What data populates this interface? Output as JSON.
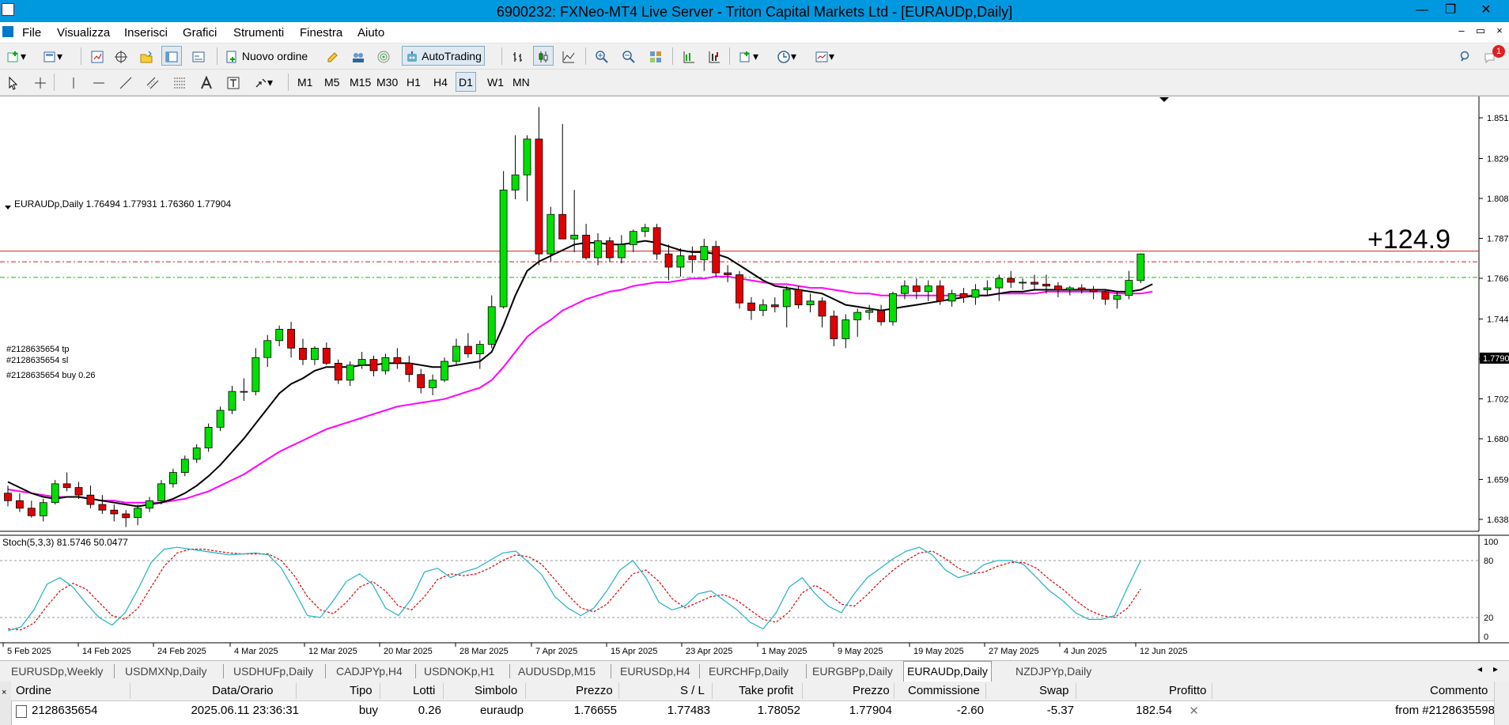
{
  "window": {
    "title": "6900232: FXNeo-MT4 Live Server - Triton Capital Markets Ltd - [EURAUDp,Daily]",
    "min_glyph": "—",
    "max_glyph": "❐",
    "close_glyph": "✕"
  },
  "menu": {
    "items": [
      "File",
      "Visualizza",
      "Inserisci",
      "Grafici",
      "Strumenti",
      "Finestra",
      "Aiuto"
    ],
    "mdi_min": "–",
    "mdi_restore": "▭",
    "mdi_close": "×"
  },
  "toolbar": {
    "new_order_label": "Nuovo ordine",
    "autotrading_label": "AutoTrading",
    "notification_count": "1"
  },
  "timeframes": [
    "M1",
    "M5",
    "M15",
    "M30",
    "H1",
    "H4",
    "D1",
    "W1",
    "MN"
  ],
  "active_timeframe": "D1",
  "chart": {
    "header": "EURAUDp,Daily  1.76494 1.77931 1.76360 1.77904",
    "profit_overlay": "+124.9",
    "current_price": "1.77904",
    "order_labels": {
      "tp": "#2128635654 tp",
      "sl": "#2128635654 sl",
      "buy": "#2128635654 buy 0.26"
    },
    "price_axis": [
      "1.85130",
      "1.82970",
      "1.80850",
      "1.78730",
      "1.76610",
      "1.74450",
      "1.72330",
      "1.70210",
      "1.68090",
      "1.65930",
      "1.63810"
    ],
    "date_axis": [
      "5 Feb 2025",
      "14 Feb 2025",
      "24 Feb 2025",
      "4 Mar 2025",
      "12 Mar 2025",
      "20 Mar 2025",
      "28 Mar 2025",
      "7 Apr 2025",
      "15 Apr 2025",
      "23 Apr 2025",
      "1 May 2025",
      "9 May 2025",
      "19 May 2025",
      "27 May 2025",
      "4 Jun 2025",
      "12 Jun 2025"
    ],
    "stoch_header": "Stoch(5,3,3) 81.5746 50.0477",
    "stoch_axis": [
      "100",
      "80",
      "20",
      "0"
    ],
    "colors": {
      "bull": "#00e000",
      "bear": "#e00000",
      "ma_fast": "#000000",
      "ma_slow": "#ff00ff",
      "stoch_main": "#20b2c0",
      "stoch_signal": "#e00000",
      "profit": "#c8b070"
    }
  },
  "chart_data": {
    "type": "candlestick",
    "symbol": "EURAUDp",
    "timeframe": "Daily",
    "candles": [
      {
        "o": 1.652,
        "h": 1.656,
        "l": 1.645,
        "c": 1.648
      },
      {
        "o": 1.648,
        "h": 1.652,
        "l": 1.642,
        "c": 1.644
      },
      {
        "o": 1.644,
        "h": 1.648,
        "l": 1.639,
        "c": 1.64
      },
      {
        "o": 1.64,
        "h": 1.649,
        "l": 1.637,
        "c": 1.647
      },
      {
        "o": 1.647,
        "h": 1.659,
        "l": 1.646,
        "c": 1.657
      },
      {
        "o": 1.657,
        "h": 1.663,
        "l": 1.653,
        "c": 1.655
      },
      {
        "o": 1.655,
        "h": 1.658,
        "l": 1.649,
        "c": 1.651
      },
      {
        "o": 1.651,
        "h": 1.656,
        "l": 1.644,
        "c": 1.646
      },
      {
        "o": 1.646,
        "h": 1.651,
        "l": 1.641,
        "c": 1.643
      },
      {
        "o": 1.643,
        "h": 1.646,
        "l": 1.637,
        "c": 1.641
      },
      {
        "o": 1.641,
        "h": 1.643,
        "l": 1.634,
        "c": 1.639
      },
      {
        "o": 1.639,
        "h": 1.646,
        "l": 1.635,
        "c": 1.644
      },
      {
        "o": 1.644,
        "h": 1.65,
        "l": 1.642,
        "c": 1.648
      },
      {
        "o": 1.648,
        "h": 1.659,
        "l": 1.646,
        "c": 1.657
      },
      {
        "o": 1.657,
        "h": 1.665,
        "l": 1.655,
        "c": 1.663
      },
      {
        "o": 1.663,
        "h": 1.672,
        "l": 1.661,
        "c": 1.67
      },
      {
        "o": 1.67,
        "h": 1.678,
        "l": 1.668,
        "c": 1.676
      },
      {
        "o": 1.676,
        "h": 1.689,
        "l": 1.674,
        "c": 1.687
      },
      {
        "o": 1.687,
        "h": 1.698,
        "l": 1.685,
        "c": 1.696
      },
      {
        "o": 1.696,
        "h": 1.709,
        "l": 1.694,
        "c": 1.706
      },
      {
        "o": 1.706,
        "h": 1.713,
        "l": 1.701,
        "c": 1.706
      },
      {
        "o": 1.706,
        "h": 1.729,
        "l": 1.704,
        "c": 1.724
      },
      {
        "o": 1.724,
        "h": 1.736,
        "l": 1.719,
        "c": 1.733
      },
      {
        "o": 1.733,
        "h": 1.741,
        "l": 1.73,
        "c": 1.739
      },
      {
        "o": 1.739,
        "h": 1.743,
        "l": 1.724,
        "c": 1.729
      },
      {
        "o": 1.729,
        "h": 1.734,
        "l": 1.72,
        "c": 1.723
      },
      {
        "o": 1.723,
        "h": 1.73,
        "l": 1.72,
        "c": 1.729
      },
      {
        "o": 1.729,
        "h": 1.732,
        "l": 1.72,
        "c": 1.721
      },
      {
        "o": 1.721,
        "h": 1.723,
        "l": 1.71,
        "c": 1.712
      },
      {
        "o": 1.712,
        "h": 1.722,
        "l": 1.709,
        "c": 1.72
      },
      {
        "o": 1.72,
        "h": 1.727,
        "l": 1.718,
        "c": 1.723
      },
      {
        "o": 1.723,
        "h": 1.725,
        "l": 1.714,
        "c": 1.717
      },
      {
        "o": 1.717,
        "h": 1.726,
        "l": 1.715,
        "c": 1.724
      },
      {
        "o": 1.724,
        "h": 1.729,
        "l": 1.718,
        "c": 1.721
      },
      {
        "o": 1.721,
        "h": 1.725,
        "l": 1.711,
        "c": 1.715
      },
      {
        "o": 1.715,
        "h": 1.718,
        "l": 1.705,
        "c": 1.708
      },
      {
        "o": 1.708,
        "h": 1.715,
        "l": 1.704,
        "c": 1.712
      },
      {
        "o": 1.712,
        "h": 1.724,
        "l": 1.711,
        "c": 1.722
      },
      {
        "o": 1.722,
        "h": 1.734,
        "l": 1.72,
        "c": 1.73
      },
      {
        "o": 1.73,
        "h": 1.737,
        "l": 1.724,
        "c": 1.726
      },
      {
        "o": 1.726,
        "h": 1.733,
        "l": 1.718,
        "c": 1.731
      },
      {
        "o": 1.731,
        "h": 1.757,
        "l": 1.729,
        "c": 1.751
      },
      {
        "o": 1.751,
        "h": 1.823,
        "l": 1.75,
        "c": 1.813
      },
      {
        "o": 1.813,
        "h": 1.842,
        "l": 1.808,
        "c": 1.821
      },
      {
        "o": 1.821,
        "h": 1.842,
        "l": 1.807,
        "c": 1.84
      },
      {
        "o": 1.84,
        "h": 1.857,
        "l": 1.773,
        "c": 1.779
      },
      {
        "o": 1.779,
        "h": 1.804,
        "l": 1.775,
        "c": 1.8
      },
      {
        "o": 1.8,
        "h": 1.848,
        "l": 1.79,
        "c": 1.787
      },
      {
        "o": 1.787,
        "h": 1.813,
        "l": 1.78,
        "c": 1.789
      },
      {
        "o": 1.789,
        "h": 1.795,
        "l": 1.776,
        "c": 1.777
      },
      {
        "o": 1.777,
        "h": 1.79,
        "l": 1.773,
        "c": 1.786
      },
      {
        "o": 1.786,
        "h": 1.788,
        "l": 1.775,
        "c": 1.777
      },
      {
        "o": 1.777,
        "h": 1.789,
        "l": 1.774,
        "c": 1.784
      },
      {
        "o": 1.784,
        "h": 1.792,
        "l": 1.78,
        "c": 1.791
      },
      {
        "o": 1.791,
        "h": 1.795,
        "l": 1.788,
        "c": 1.793
      },
      {
        "o": 1.793,
        "h": 1.795,
        "l": 1.776,
        "c": 1.779
      },
      {
        "o": 1.779,
        "h": 1.784,
        "l": 1.765,
        "c": 1.772
      },
      {
        "o": 1.772,
        "h": 1.782,
        "l": 1.767,
        "c": 1.778
      },
      {
        "o": 1.778,
        "h": 1.783,
        "l": 1.769,
        "c": 1.776
      },
      {
        "o": 1.776,
        "h": 1.787,
        "l": 1.77,
        "c": 1.783
      },
      {
        "o": 1.783,
        "h": 1.786,
        "l": 1.767,
        "c": 1.769
      },
      {
        "o": 1.769,
        "h": 1.773,
        "l": 1.764,
        "c": 1.768
      },
      {
        "o": 1.768,
        "h": 1.77,
        "l": 1.75,
        "c": 1.753
      },
      {
        "o": 1.753,
        "h": 1.756,
        "l": 1.744,
        "c": 1.749
      },
      {
        "o": 1.749,
        "h": 1.755,
        "l": 1.746,
        "c": 1.752
      },
      {
        "o": 1.752,
        "h": 1.756,
        "l": 1.748,
        "c": 1.751
      },
      {
        "o": 1.751,
        "h": 1.762,
        "l": 1.74,
        "c": 1.76
      },
      {
        "o": 1.76,
        "h": 1.762,
        "l": 1.75,
        "c": 1.752
      },
      {
        "o": 1.752,
        "h": 1.758,
        "l": 1.748,
        "c": 1.754
      },
      {
        "o": 1.754,
        "h": 1.756,
        "l": 1.74,
        "c": 1.746
      },
      {
        "o": 1.746,
        "h": 1.749,
        "l": 1.73,
        "c": 1.734
      },
      {
        "o": 1.734,
        "h": 1.747,
        "l": 1.729,
        "c": 1.744
      },
      {
        "o": 1.744,
        "h": 1.75,
        "l": 1.735,
        "c": 1.748
      },
      {
        "o": 1.748,
        "h": 1.752,
        "l": 1.744,
        "c": 1.749
      },
      {
        "o": 1.749,
        "h": 1.752,
        "l": 1.741,
        "c": 1.743
      },
      {
        "o": 1.743,
        "h": 1.759,
        "l": 1.741,
        "c": 1.758
      },
      {
        "o": 1.758,
        "h": 1.765,
        "l": 1.755,
        "c": 1.762
      },
      {
        "o": 1.762,
        "h": 1.766,
        "l": 1.755,
        "c": 1.759
      },
      {
        "o": 1.759,
        "h": 1.765,
        "l": 1.754,
        "c": 1.762
      },
      {
        "o": 1.762,
        "h": 1.765,
        "l": 1.752,
        "c": 1.754
      },
      {
        "o": 1.754,
        "h": 1.76,
        "l": 1.751,
        "c": 1.758
      },
      {
        "o": 1.758,
        "h": 1.761,
        "l": 1.753,
        "c": 1.756
      },
      {
        "o": 1.756,
        "h": 1.763,
        "l": 1.752,
        "c": 1.76
      },
      {
        "o": 1.76,
        "h": 1.765,
        "l": 1.757,
        "c": 1.761
      },
      {
        "o": 1.761,
        "h": 1.768,
        "l": 1.754,
        "c": 1.766
      },
      {
        "o": 1.766,
        "h": 1.77,
        "l": 1.761,
        "c": 1.764
      },
      {
        "o": 1.764,
        "h": 1.766,
        "l": 1.76,
        "c": 1.764
      },
      {
        "o": 1.764,
        "h": 1.768,
        "l": 1.76,
        "c": 1.763
      },
      {
        "o": 1.763,
        "h": 1.768,
        "l": 1.758,
        "c": 1.762
      },
      {
        "o": 1.762,
        "h": 1.764,
        "l": 1.756,
        "c": 1.76
      },
      {
        "o": 1.76,
        "h": 1.762,
        "l": 1.757,
        "c": 1.761
      },
      {
        "o": 1.761,
        "h": 1.763,
        "l": 1.758,
        "c": 1.76
      },
      {
        "o": 1.76,
        "h": 1.762,
        "l": 1.755,
        "c": 1.759
      },
      {
        "o": 1.759,
        "h": 1.76,
        "l": 1.752,
        "c": 1.755
      },
      {
        "o": 1.755,
        "h": 1.759,
        "l": 1.75,
        "c": 1.757
      },
      {
        "o": 1.757,
        "h": 1.77,
        "l": 1.755,
        "c": 1.765
      },
      {
        "o": 1.76494,
        "h": 1.77931,
        "l": 1.7636,
        "c": 1.77904
      }
    ],
    "ma_fast": [
      1.658,
      1.655,
      1.652,
      1.65,
      1.649,
      1.65,
      1.65,
      1.649,
      1.648,
      1.647,
      1.646,
      1.645,
      1.646,
      1.647,
      1.649,
      1.652,
      1.656,
      1.661,
      1.667,
      1.674,
      1.681,
      1.689,
      1.697,
      1.705,
      1.71,
      1.713,
      1.717,
      1.719,
      1.719,
      1.719,
      1.72,
      1.72,
      1.721,
      1.721,
      1.721,
      1.72,
      1.719,
      1.719,
      1.72,
      1.721,
      1.722,
      1.727,
      1.741,
      1.757,
      1.77,
      1.775,
      1.778,
      1.781,
      1.784,
      1.785,
      1.785,
      1.784,
      1.784,
      1.785,
      1.786,
      1.785,
      1.783,
      1.781,
      1.78,
      1.78,
      1.779,
      1.777,
      1.773,
      1.769,
      1.765,
      1.762,
      1.761,
      1.76,
      1.759,
      1.758,
      1.755,
      1.752,
      1.751,
      1.75,
      1.749,
      1.75,
      1.751,
      1.752,
      1.753,
      1.754,
      1.755,
      1.756,
      1.757,
      1.757,
      1.758,
      1.759,
      1.759,
      1.76,
      1.76,
      1.76,
      1.76,
      1.76,
      1.76,
      1.76,
      1.759,
      1.759,
      1.76,
      1.763
    ],
    "ma_slow": [
      1.654,
      1.653,
      1.652,
      1.651,
      1.65,
      1.65,
      1.65,
      1.649,
      1.648,
      1.648,
      1.647,
      1.647,
      1.647,
      1.647,
      1.648,
      1.649,
      1.651,
      1.653,
      1.656,
      1.659,
      1.662,
      1.666,
      1.67,
      1.674,
      1.677,
      1.68,
      1.683,
      1.686,
      1.688,
      1.69,
      1.692,
      1.694,
      1.696,
      1.698,
      1.699,
      1.7,
      1.701,
      1.702,
      1.704,
      1.706,
      1.708,
      1.712,
      1.719,
      1.727,
      1.735,
      1.74,
      1.744,
      1.749,
      1.752,
      1.755,
      1.757,
      1.759,
      1.76,
      1.762,
      1.763,
      1.764,
      1.764,
      1.765,
      1.766,
      1.766,
      1.767,
      1.767,
      1.766,
      1.765,
      1.764,
      1.763,
      1.763,
      1.762,
      1.761,
      1.761,
      1.76,
      1.759,
      1.758,
      1.758,
      1.757,
      1.757,
      1.757,
      1.757,
      1.757,
      1.757,
      1.757,
      1.757,
      1.757,
      1.757,
      1.758,
      1.758,
      1.758,
      1.758,
      1.759,
      1.759,
      1.759,
      1.759,
      1.759,
      1.759,
      1.758,
      1.758,
      1.758,
      1.759
    ],
    "stoch_main": [
      6,
      10,
      28,
      55,
      62,
      52,
      35,
      20,
      12,
      25,
      50,
      78,
      92,
      94,
      92,
      90,
      88,
      86,
      87,
      88,
      86,
      72,
      48,
      22,
      20,
      38,
      58,
      66,
      55,
      30,
      22,
      40,
      68,
      72,
      62,
      68,
      72,
      80,
      88,
      90,
      78,
      65,
      42,
      30,
      22,
      30,
      48,
      70,
      80,
      62,
      36,
      28,
      32,
      45,
      48,
      38,
      28,
      15,
      8,
      25,
      52,
      62,
      45,
      32,
      25,
      45,
      62,
      72,
      82,
      90,
      94,
      86,
      70,
      62,
      66,
      76,
      80,
      80,
      76,
      62,
      48,
      38,
      25,
      18,
      18,
      22,
      52,
      80
    ],
    "stoch_signal": [
      8,
      7,
      14,
      32,
      48,
      56,
      50,
      36,
      22,
      18,
      30,
      52,
      74,
      88,
      92,
      92,
      90,
      88,
      87,
      87,
      87,
      80,
      64,
      42,
      28,
      24,
      36,
      52,
      58,
      48,
      32,
      28,
      42,
      60,
      66,
      64,
      66,
      72,
      80,
      86,
      84,
      76,
      60,
      44,
      30,
      26,
      34,
      50,
      66,
      70,
      58,
      40,
      30,
      36,
      42,
      44,
      38,
      28,
      18,
      15,
      26,
      46,
      54,
      46,
      34,
      32,
      44,
      58,
      70,
      80,
      88,
      90,
      82,
      72,
      66,
      68,
      74,
      78,
      78,
      72,
      60,
      50,
      38,
      28,
      22,
      20,
      30,
      50
    ],
    "order_levels": {
      "tp": 1.78052,
      "sl": 1.77483,
      "entry": 1.76655
    },
    "price_range": [
      1.6326,
      1.8618
    ],
    "stoch_range": [
      0,
      100
    ],
    "stoch_levels": [
      20,
      80
    ]
  },
  "tabs": {
    "items": [
      "EURUSDp,Weekly",
      "USDMXNp,Daily",
      "USDHUFp,Daily",
      "CADJPYp,H4",
      "USDNOKp,H1",
      "AUDUSDp,M15",
      "EURUSDp,H4",
      "EURCHFp,Daily",
      "EURGBPp,Daily",
      "EURAUDp,Daily",
      "NZDJPYp,Daily"
    ],
    "active": "EURAUDp,Daily"
  },
  "terminal": {
    "columns": [
      "Ordine",
      "Data/Orario",
      "Tipo",
      "Lotti",
      "Simbolo",
      "Prezzo",
      "S / L",
      "Take profit",
      "Prezzo",
      "Commissione",
      "Swap",
      "Profitto",
      "Commento"
    ],
    "row": {
      "ordine": "2128635654",
      "data": "2025.06.11 23:36:31",
      "tipo": "buy",
      "lotti": "0.26",
      "simbolo": "euraudp",
      "prezzo": "1.76655",
      "sl": "1.77483",
      "tp": "1.78052",
      "prezzo_corrente": "1.77904",
      "commissione": "-2.60",
      "swap": "-5.37",
      "profitto": "182.54",
      "commento": "from #2128635598"
    }
  }
}
